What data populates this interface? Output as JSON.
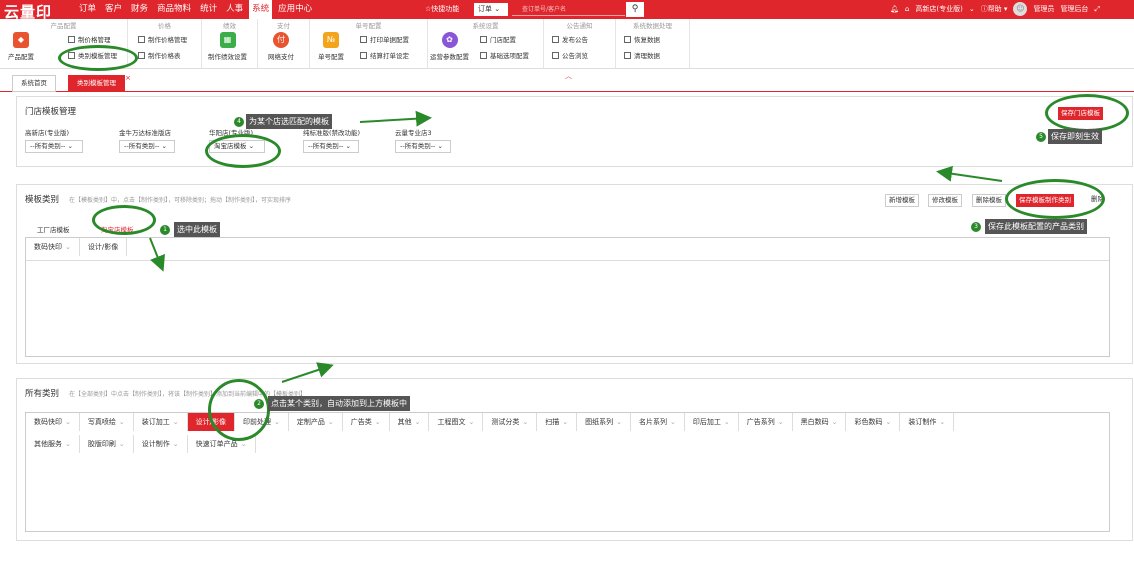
{
  "app": {
    "logo": "云量印",
    "logo_sub": "Y U N Y I N"
  },
  "topnav": {
    "items": [
      "订单",
      "客户",
      "财务",
      "商品物料",
      "统计",
      "人事",
      "系统",
      "应用中心"
    ],
    "quick": "☆快捷功能",
    "order_dropdown": "订单",
    "search_placeholder": "查订单号/客户名",
    "user_store": "高新店(专业版)",
    "help": "帮助",
    "admin": "管理员",
    "backend": "管理后台"
  },
  "ribbon": {
    "groups": {
      "product": "产品配置",
      "price": "价格",
      "perf": "绩效",
      "pay": "支付",
      "receipt": "单号配置",
      "sys": "系统设置",
      "notice": "公告通知",
      "data": "系统数据处理"
    },
    "buttons": {
      "product_config": "产品配置",
      "make_price_mgmt": "制价格管理",
      "category_template": "类别模板管理",
      "make_price_mgmt2": "制作价格管理",
      "make_price_table": "制作价格表",
      "perf_setting": "制作绩效设置",
      "online_pay": "网络支付",
      "receipt_config": "单号配置",
      "print_receipt": "打印单据配置",
      "settle_print": "结算打单设定",
      "store_config": "门店配置",
      "base_options": "基础选项配置",
      "ops_params": "运营参数配置",
      "publish_notice": "发布公告",
      "browse_notice": "公告浏览",
      "restore_data": "恢复数据",
      "clean_data": "清理数据"
    }
  },
  "tabs": [
    {
      "label": "系统首页"
    },
    {
      "label": "类别模板管理"
    }
  ],
  "store_panel": {
    "title": "门店模板管理",
    "stores": [
      {
        "name": "高新店(专业版)",
        "value": "--所有类别--"
      },
      {
        "name": "金牛万达标准版店",
        "value": "--所有类别--"
      },
      {
        "name": "华阳店(专业版)",
        "value": "淘宝店模板"
      },
      {
        "name": "纯标准版(禁改功能)",
        "value": "--所有类别--"
      },
      {
        "name": "云量专业店3",
        "value": "--所有类别--"
      }
    ],
    "save_button": "保存门店模板"
  },
  "template_panel": {
    "title": "模板类别",
    "hint": "在【模板类别】中，点击【制作类别】，可移除类别；拖动【制作类别】，可实现排序",
    "buttons": {
      "new": "新增模板",
      "edit": "修改模板",
      "delete": "删除模板",
      "save": "保存模板制作类别",
      "extra": "删除"
    },
    "sub_tabs": [
      "工厂店模板",
      "淘宝店模板"
    ],
    "categories": [
      "数码快印",
      "设计/影像"
    ]
  },
  "all_panel": {
    "title": "所有类别",
    "hint": "在【全部类别】中点击【制作类别】，将该【制作类别】添加到当前编辑中的【模板类别】",
    "row1": [
      "数码快印",
      "写真喷绘",
      "装订加工",
      "设计/影像",
      "印前处理",
      "定制产品",
      "广告类",
      "其他",
      "工程图文",
      "测试分类",
      "扫描",
      "图纸系列",
      "名片系列",
      "印后加工",
      "广告系列",
      "黑白数码",
      "彩色数码",
      "装订制作"
    ],
    "row2": [
      "其他服务",
      "胶版印刷",
      "设计制作",
      "快速订单产品"
    ]
  },
  "annotations": {
    "a1": "选中此模板",
    "a2": "点击某个类别，自动添加到上方模板中",
    "a3": "保存此模板配置的产品类别",
    "a4": "为某个店选匹配的模板",
    "a5": "保存即刻生效",
    "n1": "1",
    "n2": "2",
    "n3": "3",
    "n4": "4",
    "n5": "5"
  },
  "colors": {
    "brand": "#e0262d",
    "annotation": "#2a8a2a"
  }
}
